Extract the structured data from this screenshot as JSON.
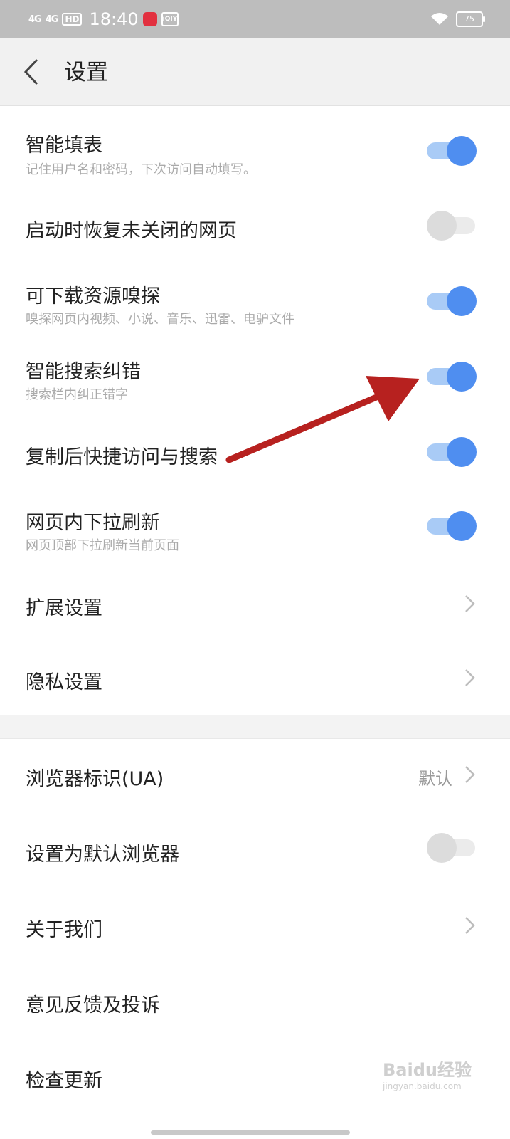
{
  "status": {
    "sim1": "4G",
    "sim2": "4G",
    "hd": "HD",
    "time": "18:40",
    "app_icon2": "iQIY",
    "battery": "75"
  },
  "header": {
    "title": "设置"
  },
  "settings": [
    {
      "title": "智能填表",
      "subtitle": "记住用户名和密码，下次访问自动填写。",
      "toggle": true
    },
    {
      "title": "启动时恢复未关闭的网页",
      "toggle": false
    },
    {
      "title": "可下载资源嗅探",
      "subtitle": "嗅探网页内视频、小说、音乐、迅雷、电驴文件",
      "toggle": true
    },
    {
      "title": "智能搜索纠错",
      "subtitle": "搜索栏内纠正错字",
      "toggle": true
    },
    {
      "title": "复制后快捷访问与搜索",
      "toggle": true
    },
    {
      "title": "网页内下拉刷新",
      "subtitle": "网页顶部下拉刷新当前页面",
      "toggle": true
    },
    {
      "title": "扩展设置"
    },
    {
      "title": "隐私设置"
    }
  ],
  "settings2": [
    {
      "title": "浏览器标识(UA)",
      "value": "默认"
    },
    {
      "title": "设置为默认浏览器",
      "toggle": false
    },
    {
      "title": "关于我们"
    },
    {
      "title": "意见反馈及投诉"
    },
    {
      "title": "检查更新"
    }
  ],
  "watermark": "Baidu经验",
  "watermark_url": "jingyan.baidu.com",
  "colors": {
    "toggle_on": "#4f8ef0",
    "toggle_on_track": "#a9cbf6",
    "arrow": "#b7211f",
    "header_bg": "#f1f1f1"
  }
}
